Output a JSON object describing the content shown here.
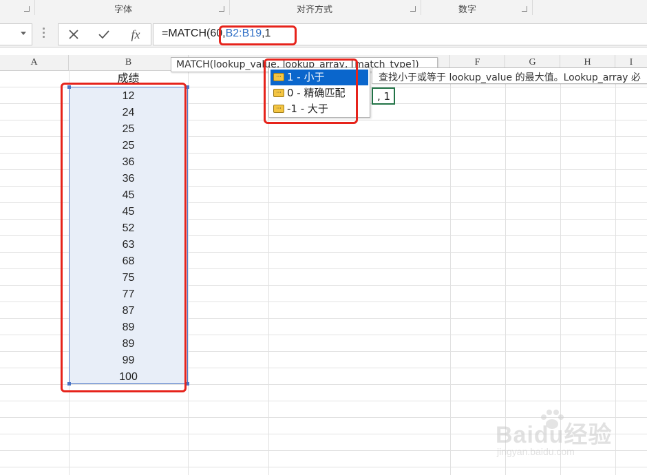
{
  "ribbon": {
    "groups": [
      "字体",
      "对齐方式",
      "数字"
    ]
  },
  "formula_bar": {
    "cancel_icon": "x-icon",
    "enter_icon": "check-icon",
    "fx_label": "fx",
    "formula_prefix": "=MATCH(60,",
    "formula_ref": "B2:B19",
    "formula_suffix": ",1"
  },
  "columns": [
    "A",
    "B",
    "F",
    "G",
    "H",
    "I"
  ],
  "sheet": {
    "header": "成绩",
    "values": [
      "12",
      "24",
      "25",
      "25",
      "36",
      "36",
      "45",
      "45",
      "52",
      "63",
      "68",
      "75",
      "77",
      "87",
      "89",
      "89",
      "99",
      "100"
    ],
    "active_cell_text": ", 1"
  },
  "tooltip": {
    "signature": "MATCH(lookup_value, lookup_array, [match_type])",
    "description": "查找小于或等于 lookup_value 的最大值。Lookup_array 必"
  },
  "autocomplete": {
    "items": [
      "1 - 小于",
      "0 - 精确匹配",
      "-1 - 大于"
    ]
  },
  "watermark": {
    "text": "Baidu经验",
    "url": "jingyan.baidu.com"
  },
  "colors": {
    "selection_fill": "#e8eef8",
    "selection_border": "#4a74c4",
    "annotation_red": "#e6231b",
    "active_cell_green": "#217346",
    "reference_blue": "#2f6fc6"
  }
}
